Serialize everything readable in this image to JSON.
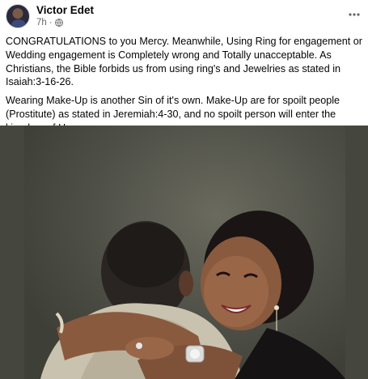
{
  "post": {
    "author": "Victor Edet",
    "time": "7h",
    "separator": "·",
    "more_icon": "more-horizontal-icon",
    "privacy_icon": "globe-icon",
    "paragraphs": [
      "CONGRATULATIONS to you Mercy. Meanwhile, Using Ring for engagement or Wedding engagement is Completely wrong and Totally unacceptable. As Christians, the Bible forbids us from using ring's and Jewelries as stated in Isaiah:3-16-26.",
      "Wearing Make-Up is another Sin of it's own. Make-Up are for spoilt people (Prostitute) as stated in Jeremiah:4-30, and no spoilt person will enter the kingdom of Heaven."
    ]
  },
  "colors": {
    "text": "#050505",
    "secondary": "#65676b",
    "background": "#ffffff"
  }
}
